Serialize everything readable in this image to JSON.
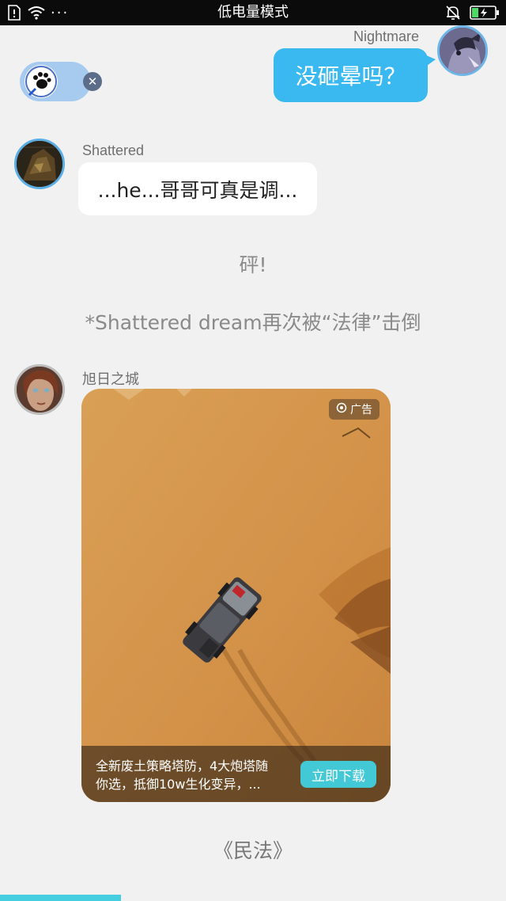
{
  "status_bar": {
    "title": "低电量模式",
    "dots": "···"
  },
  "messages": [
    {
      "sender": "Nightmare",
      "text": "没砸晕吗？",
      "side": "right"
    },
    {
      "sender": "Shattered",
      "text": "...he...哥哥可真是调...",
      "side": "left"
    }
  ],
  "narration": {
    "line1": "砰!",
    "line2": "*Shattered dream再次被“法律”击倒",
    "line3": "《民法》"
  },
  "ad": {
    "sender": "旭日之城",
    "tag": "广告",
    "text_line1": "全新废土策略塔防，4大炮塔随",
    "text_line2": "你选，抵御10w生化变异，...",
    "button": "立即下载"
  },
  "colors": {
    "accent_blue": "#39b9ef",
    "ad_button": "#43c8d5",
    "background": "#f1f1f1"
  }
}
